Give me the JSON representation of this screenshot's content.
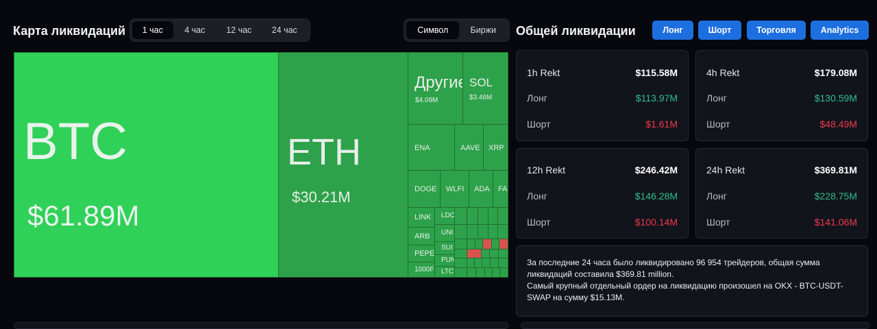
{
  "left_title": "Карта ликвидаций",
  "time_tabs": [
    {
      "label": "1 час",
      "active": true
    },
    {
      "label": "4 час",
      "active": false
    },
    {
      "label": "12 час",
      "active": false
    },
    {
      "label": "24 час",
      "active": false
    }
  ],
  "view_tabs": [
    {
      "label": "Символ",
      "active": true
    },
    {
      "label": "Биржи",
      "active": false
    }
  ],
  "right_title": "Общей ликвидации",
  "buttons": {
    "long": "Лонг",
    "short": "Шорт",
    "trade": "Торговля",
    "analytics": "Analytics"
  },
  "colors": {
    "accent": "#1d6fe0",
    "long": "#2fbf8d",
    "short": "#f0394d",
    "tile_big": "#30d158",
    "tile": "#2ea24a"
  },
  "treemap": [
    {
      "symbol": "BTC",
      "value": "$61.89M"
    },
    {
      "symbol": "ETH",
      "value": "$30.21M"
    },
    {
      "symbol": "Другие",
      "value": "$4.09M"
    },
    {
      "symbol": "SOL",
      "value": "$3.46M"
    },
    {
      "symbol": "ENA",
      "value": ""
    },
    {
      "symbol": "AAVE",
      "value": ""
    },
    {
      "symbol": "XRP",
      "value": ""
    },
    {
      "symbol": "DOGE",
      "value": ""
    },
    {
      "symbol": "WLFI",
      "value": ""
    },
    {
      "symbol": "ADA",
      "value": ""
    },
    {
      "symbol": "FA",
      "value": ""
    },
    {
      "symbol": "LINK",
      "value": ""
    },
    {
      "symbol": "LDO",
      "value": ""
    },
    {
      "symbol": "ARB",
      "value": ""
    },
    {
      "symbol": "UNI",
      "value": ""
    },
    {
      "symbol": "PEPE",
      "value": ""
    },
    {
      "symbol": "SUI",
      "value": ""
    },
    {
      "symbol": "PUN",
      "value": ""
    },
    {
      "symbol": "1000F",
      "value": ""
    },
    {
      "symbol": "LTC",
      "value": ""
    }
  ],
  "stats": [
    {
      "period": "1h Rekt",
      "total": "$115.58M",
      "long_label": "Лонг",
      "long": "$113.97M",
      "short_label": "Шорт",
      "short": "$1.61M"
    },
    {
      "period": "4h Rekt",
      "total": "$179.08M",
      "long_label": "Лонг",
      "long": "$130.59M",
      "short_label": "Шорт",
      "short": "$48.49M"
    },
    {
      "period": "12h Rekt",
      "total": "$246.42M",
      "long_label": "Лонг",
      "long": "$146.28M",
      "short_label": "Шорт",
      "short": "$100.14M"
    },
    {
      "period": "24h Rekt",
      "total": "$369.81M",
      "long_label": "Лонг",
      "long": "$228.75M",
      "short_label": "Шорт",
      "short": "$141.06M"
    }
  ],
  "summary": {
    "line1": "За последние 24 часа было ликвидировано 96 954 трейдеров, общая сумма ликвидаций составила $369.81 million.",
    "line2": "Самый крупный отдельный ордер на ликвидацию произошел на OKX - BTC-USDT-SWAP на сумму $15.13M."
  }
}
